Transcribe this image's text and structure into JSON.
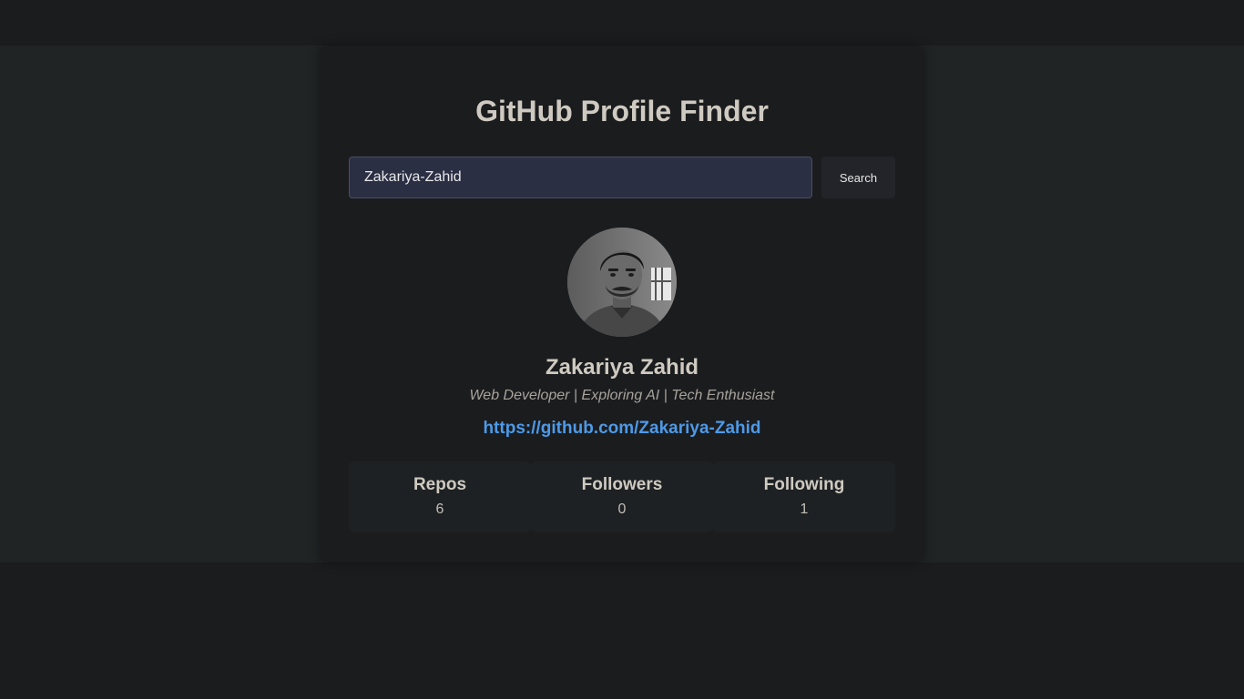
{
  "app": {
    "title": "GitHub Profile Finder"
  },
  "search": {
    "value": "Zakariya-Zahid",
    "button_label": "Search"
  },
  "profile": {
    "avatar_icon": "user-avatar-photo",
    "name": "Zakariya Zahid",
    "bio": "Web Developer | Exploring AI | Tech Enthusiast",
    "link": "https://github.com/Zakariya-Zahid"
  },
  "stats": [
    {
      "label": "Repos",
      "value": "6"
    },
    {
      "label": "Followers",
      "value": "0"
    },
    {
      "label": "Following",
      "value": "1"
    }
  ],
  "colors": {
    "page_background": "#1a1c1e",
    "band_background": "#202425",
    "card_background": "#1b1c1e",
    "input_background": "#2b2f44",
    "link": "#4d9ae8",
    "heading_text": "#cfcac1"
  }
}
